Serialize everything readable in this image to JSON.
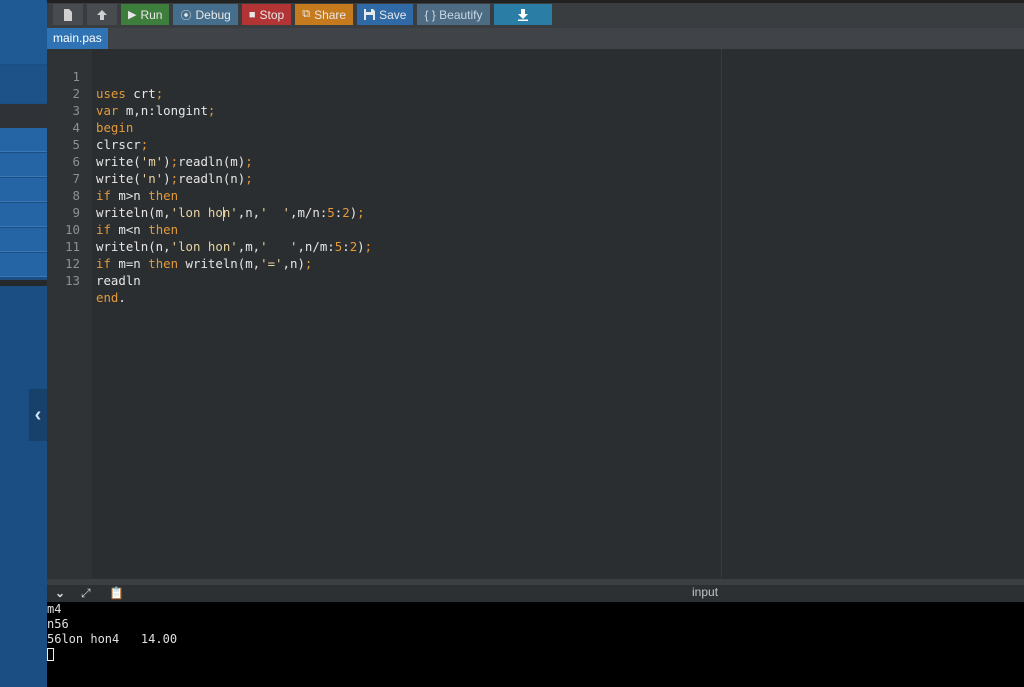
{
  "toolbar": {
    "run_label": "Run",
    "debug_label": "Debug",
    "stop_label": "Stop",
    "share_label": "Share",
    "save_label": "Save",
    "beautify_label": "{ } Beautify"
  },
  "tab": {
    "name": "main.pas"
  },
  "editor": {
    "line_numbers": [
      "1",
      "2",
      "3",
      "4",
      "5",
      "6",
      "7",
      "8",
      "9",
      "10",
      "11",
      "12",
      "13"
    ]
  },
  "panel": {
    "input_label": "input"
  },
  "console": {
    "lines": [
      "m4",
      "n56",
      "56lon hon4   14.00"
    ]
  },
  "colors": {
    "run": "#3e7e3c",
    "stop": "#b23434",
    "share": "#c67a1e",
    "save": "#2f6aa6",
    "keyword": "#e39a3c"
  }
}
